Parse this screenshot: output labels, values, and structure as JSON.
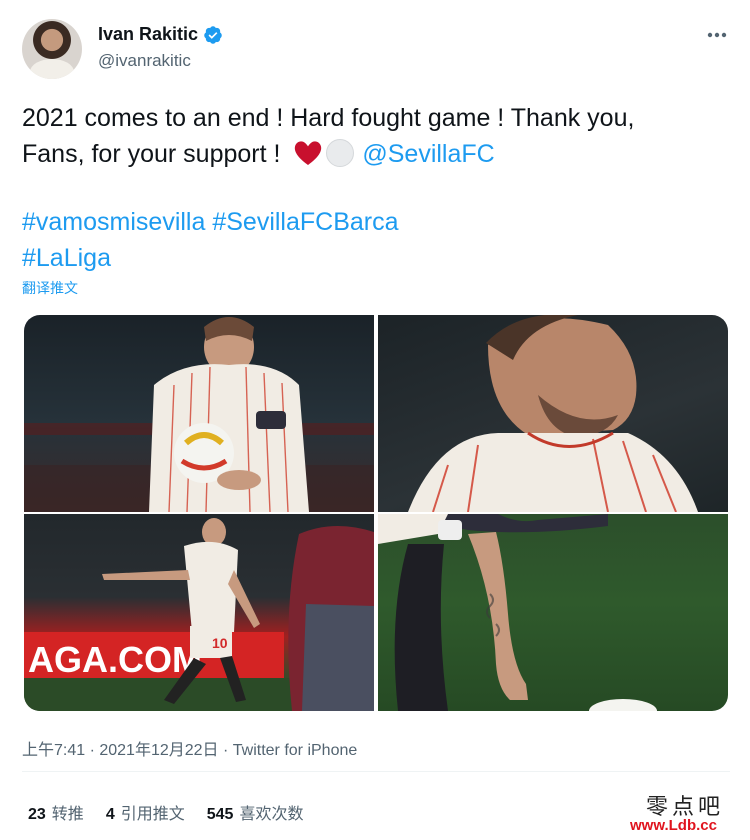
{
  "author": {
    "name": "Ivan Rakitic",
    "handle": "@ivanrakitic",
    "verified": true
  },
  "tweet": {
    "line1": "2021 comes to an end ! Hard fought game ! Thank you,",
    "line2_text": "Fans, for your support ! ",
    "emoji": [
      "red-heart",
      "white-circle"
    ],
    "mention": "@SevillaFC",
    "hashtags_line1": "#vamosmisevilla #SevillaFCBarca",
    "hashtags_line2": "#LaLiga",
    "translate_label": "翻译推文"
  },
  "media": {
    "photos": [
      {
        "label": "photo-holding-ball"
      },
      {
        "label": "photo-profile-closeup"
      },
      {
        "label": "photo-dribbling"
      },
      {
        "label": "photo-placing-ball"
      }
    ],
    "stadium_banner_text": "AGA.COM",
    "shirt_number": "10"
  },
  "meta": {
    "timestamp": "上午7:41 · 2021年12月22日 · Twitter for iPhone"
  },
  "stats": {
    "retweets_count": "23",
    "retweets_label": "转推",
    "quotes_count": "4",
    "quotes_label": "引用推文",
    "likes_count": "545",
    "likes_label": "喜欢次数"
  },
  "watermark": {
    "cn": "零点吧",
    "url": "www.Ldb.cc"
  },
  "colors": {
    "link": "#1d9bf0",
    "secondary_text": "#536471",
    "verified": "#1d9bf0",
    "heart": "#c8102e"
  }
}
